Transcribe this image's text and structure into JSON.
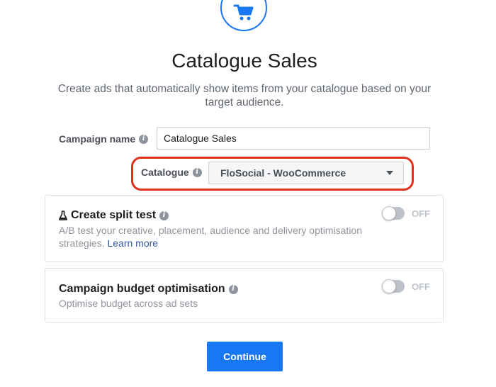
{
  "colors": {
    "accent": "#1877f2",
    "highlight_border": "#e0311f",
    "link": "#365899",
    "toggle_off": "#bec3c9"
  },
  "header": {
    "icon": "shopping-cart-icon",
    "title": "Catalogue Sales",
    "subtitle": "Create ads that automatically show items from your catalogue based on your target audience."
  },
  "form": {
    "campaign_name_label": "Campaign name",
    "campaign_name_value": "Catalogue Sales",
    "catalogue_label": "Catalogue",
    "catalogue_value": "FloSocial - WooCommerce"
  },
  "split_test": {
    "icon": "flask-icon",
    "title": "Create split test",
    "description": "A/B test your creative, placement, audience and delivery optimisation strategies.",
    "learn_more": "Learn more",
    "toggle_state": "OFF"
  },
  "budget": {
    "title": "Campaign budget optimisation",
    "description": "Optimise budget across ad sets",
    "toggle_state": "OFF"
  },
  "actions": {
    "continue_label": "Continue"
  }
}
